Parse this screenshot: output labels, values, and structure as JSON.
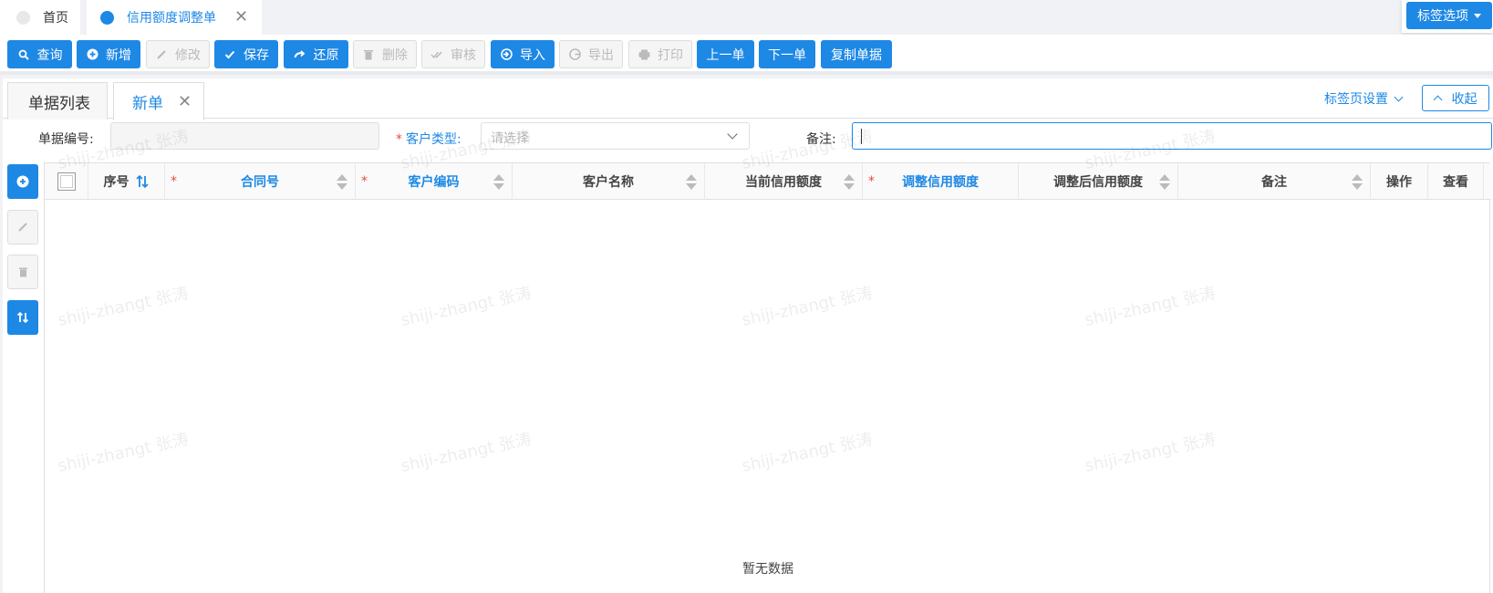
{
  "top_tabs": [
    {
      "label": "首页",
      "active": false
    },
    {
      "label": "信用额度调整单",
      "active": true,
      "close": "✕"
    }
  ],
  "tag_options": {
    "label": "标签选项"
  },
  "toolbar": {
    "query": "查询",
    "add": "新增",
    "edit": "修改",
    "save": "保存",
    "restore": "还原",
    "delete": "删除",
    "audit": "审核",
    "import": "导入",
    "export": "导出",
    "print": "打印",
    "prev": "上一单",
    "next": "下一单",
    "copy": "复制单据"
  },
  "sub_tabs": [
    {
      "label": "单据列表",
      "active": false
    },
    {
      "label": "新单",
      "active": true,
      "close": "✕"
    }
  ],
  "tab_settings": {
    "label": "标签页设置"
  },
  "collapse": {
    "label": "收起"
  },
  "form": {
    "doc_no_label": "单据编号:",
    "doc_no_value": "",
    "customer_type_label": "客户类型:",
    "customer_type_placeholder": "请选择",
    "remark_label": "备注:",
    "remark_value": ""
  },
  "grid": {
    "columns": [
      {
        "label": "序号"
      },
      {
        "label": "合同号",
        "required": true
      },
      {
        "label": "客户编码",
        "required": true
      },
      {
        "label": "客户名称"
      },
      {
        "label": "当前信用额度"
      },
      {
        "label": "调整信用额度",
        "required": true
      },
      {
        "label": "调整后信用额度"
      },
      {
        "label": "备注"
      },
      {
        "label": "操作"
      },
      {
        "label": "查看"
      }
    ],
    "rows": [],
    "empty_text": "暂无数据"
  },
  "watermark": "shiji-zhangt 张涛",
  "colors": {
    "primary": "#1e88e5",
    "required": "#e74c3c"
  }
}
